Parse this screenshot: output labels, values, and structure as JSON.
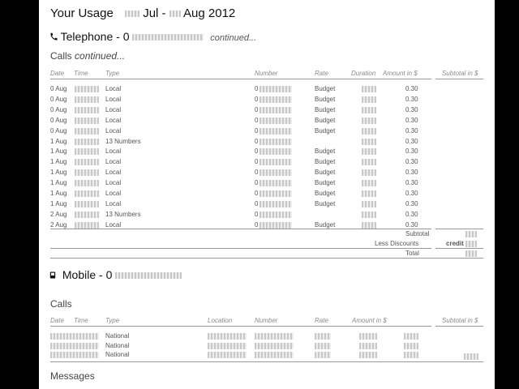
{
  "usage": {
    "title": "Your Usage",
    "period_sep": "Jul -",
    "period_end": "Aug 2012"
  },
  "telephone": {
    "label": "Telephone - 0",
    "continued": "continued...",
    "calls_title": "Calls",
    "calls_continued": "continued...",
    "headers": {
      "date": "Date",
      "time": "Time",
      "type": "Type",
      "number": "Number",
      "rate": "Rate",
      "duration": "Duration",
      "amount": "Amount in $",
      "subtotal": "Subtotal in $"
    },
    "rows": [
      {
        "date": "0 Aug",
        "type": "Local",
        "number": "0",
        "rate": "Budget",
        "amount": "0.30"
      },
      {
        "date": "0 Aug",
        "type": "Local",
        "number": "0",
        "rate": "Budget",
        "amount": "0.30"
      },
      {
        "date": "0 Aug",
        "type": "Local",
        "number": "0",
        "rate": "Budget",
        "amount": "0.30"
      },
      {
        "date": "0 Aug",
        "type": "Local",
        "number": "0",
        "rate": "Budget",
        "amount": "0.30"
      },
      {
        "date": "0 Aug",
        "type": "Local",
        "number": "0",
        "rate": "Budget",
        "amount": "0.30"
      },
      {
        "date": "1 Aug",
        "type": "13 Numbers",
        "number": "0",
        "rate": "",
        "amount": "0.30"
      },
      {
        "date": "1 Aug",
        "type": "Local",
        "number": "0",
        "rate": "Budget",
        "amount": "0.30"
      },
      {
        "date": "1 Aug",
        "type": "Local",
        "number": "0",
        "rate": "Budget",
        "amount": "0.30"
      },
      {
        "date": "1 Aug",
        "type": "Local",
        "number": "0",
        "rate": "Budget",
        "amount": "0.30"
      },
      {
        "date": "1 Aug",
        "type": "Local",
        "number": "0",
        "rate": "Budget",
        "amount": "0.30"
      },
      {
        "date": "1 Aug",
        "type": "Local",
        "number": "0",
        "rate": "Budget",
        "amount": "0.30"
      },
      {
        "date": "1 Aug",
        "type": "Local",
        "number": "0",
        "rate": "Budget",
        "amount": "0.30"
      },
      {
        "date": "2 Aug",
        "type": "13 Numbers",
        "number": "0",
        "rate": "",
        "amount": "0.30"
      },
      {
        "date": "2 Aug",
        "type": "Local",
        "number": "0",
        "rate": "Budget",
        "amount": "0.30"
      }
    ],
    "summary": {
      "subtotal": "Subtotal",
      "discounts": "Less Discounts",
      "credit": "credit",
      "total": "Total"
    }
  },
  "mobile": {
    "label": "Mobile - 0",
    "calls_title": "Calls",
    "headers": {
      "date": "Date",
      "time": "Time",
      "type": "Type",
      "location": "Location",
      "number": "Number",
      "rate": "Rate",
      "amount": "Amount in $",
      "subtotal": "Subtotal in $"
    },
    "rows": [
      {
        "type": "National"
      },
      {
        "type": "National"
      },
      {
        "type": "National"
      }
    ],
    "messages_title": "Messages"
  }
}
